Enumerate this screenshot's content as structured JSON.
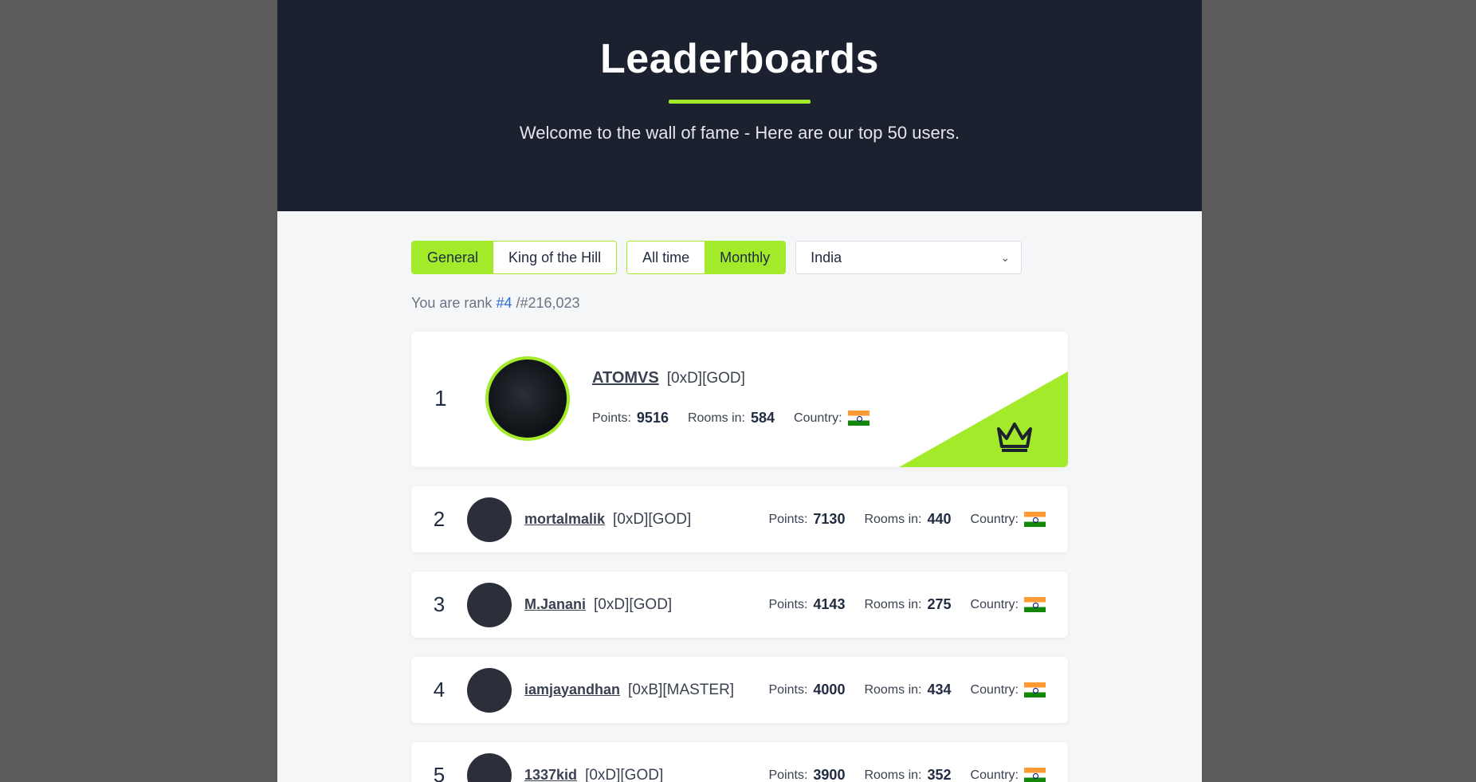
{
  "hero": {
    "title": "Leaderboards",
    "subtitle": "Welcome to the wall of fame - Here are our top 50 users."
  },
  "filters": {
    "category": [
      {
        "label": "General",
        "active": true
      },
      {
        "label": "King of the Hill",
        "active": false
      }
    ],
    "period": [
      {
        "label": "All time",
        "active": false
      },
      {
        "label": "Monthly",
        "active": true
      }
    ],
    "country_select": {
      "value": "India"
    }
  },
  "rank_info": {
    "prefix": "You are rank",
    "rank": "#4",
    "total": "/#216,023"
  },
  "labels": {
    "points": "Points:",
    "rooms": "Rooms in:",
    "country": "Country:"
  },
  "users": [
    {
      "rank": "1",
      "name": "ATOMVS",
      "tag": "[0xD][GOD]",
      "points": "9516",
      "rooms": "584",
      "country_flag": "india-flag"
    },
    {
      "rank": "2",
      "name": "mortalmalik",
      "tag": "[0xD][GOD]",
      "points": "7130",
      "rooms": "440",
      "country_flag": "india-flag"
    },
    {
      "rank": "3",
      "name": "M.Janani",
      "tag": "[0xD][GOD]",
      "points": "4143",
      "rooms": "275",
      "country_flag": "india-flag"
    },
    {
      "rank": "4",
      "name": "iamjayandhan",
      "tag": "[0xB][MASTER]",
      "points": "4000",
      "rooms": "434",
      "country_flag": "india-flag"
    },
    {
      "rank": "5",
      "name": "1337kid",
      "tag": "[0xD][GOD]",
      "points": "3900",
      "rooms": "352",
      "country_flag": "india-flag"
    }
  ],
  "colors": {
    "accent": "#a3ea2a",
    "hero_bg": "#1c2130",
    "link": "#2d6fd3"
  },
  "icons": {
    "crown": "crown-icon",
    "select_chevron": "chevron-down-icon"
  }
}
